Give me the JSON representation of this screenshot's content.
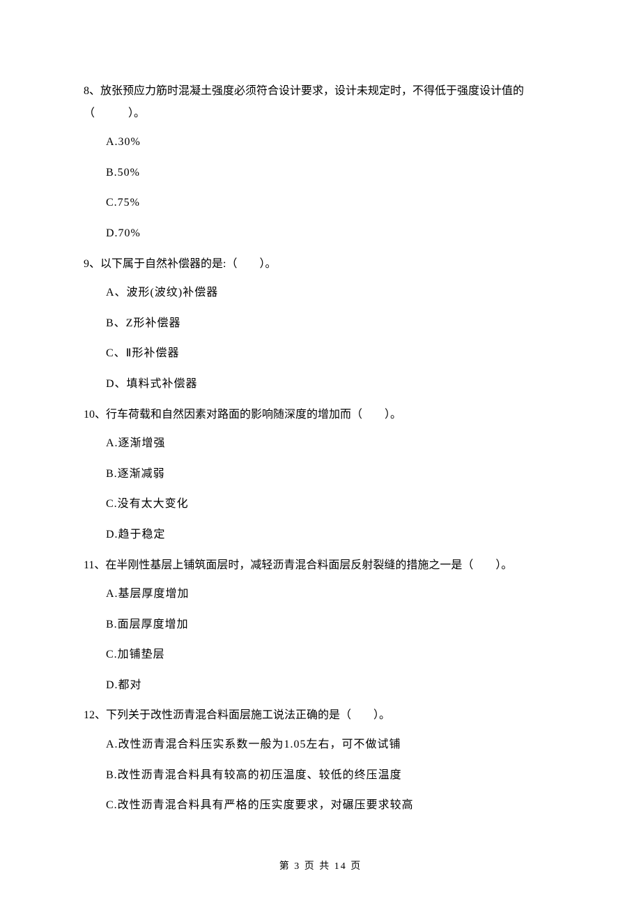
{
  "questions": [
    {
      "num": "8、",
      "stem_a": "放张预应力筋时混凝土强度必须符合设计要求，设计未规定时，不得低于强度设计值的",
      "stem_b": "（　　　）。",
      "options": [
        "A.30%",
        "B.50%",
        "C.75%",
        "D.70%"
      ]
    },
    {
      "num": "9、",
      "stem_a": "以下属于自然补偿器的是:（　　）。",
      "stem_b": "",
      "options": [
        "A、波形(波纹)补偿器",
        "B、Z形补偿器",
        "C、Ⅱ形补偿器",
        "D、填料式补偿器"
      ]
    },
    {
      "num": "10、",
      "stem_a": "行车荷载和自然因素对路面的影响随深度的增加而（　　）。",
      "stem_b": "",
      "options": [
        "A.逐渐增强",
        "B.逐渐减弱",
        "C.没有太大变化",
        "D.趋于稳定"
      ]
    },
    {
      "num": "11、",
      "stem_a": "在半刚性基层上铺筑面层时，减轻沥青混合料面层反射裂缝的措施之一是（　　）。",
      "stem_b": "",
      "options": [
        "A.基层厚度增加",
        "B.面层厚度增加",
        "C.加铺垫层",
        "D.都对"
      ]
    },
    {
      "num": "12、",
      "stem_a": "下列关于改性沥青混合料面层施工说法正确的是（　　）。",
      "stem_b": "",
      "options": [
        "A.改性沥青混合料压实系数一般为1.05左右，可不做试铺",
        "B.改性沥青混合料具有较高的初压温度、较低的终压温度",
        "C.改性沥青混合料具有严格的压实度要求，对碾压要求较高"
      ]
    }
  ],
  "footer": "第 3 页 共 14 页"
}
